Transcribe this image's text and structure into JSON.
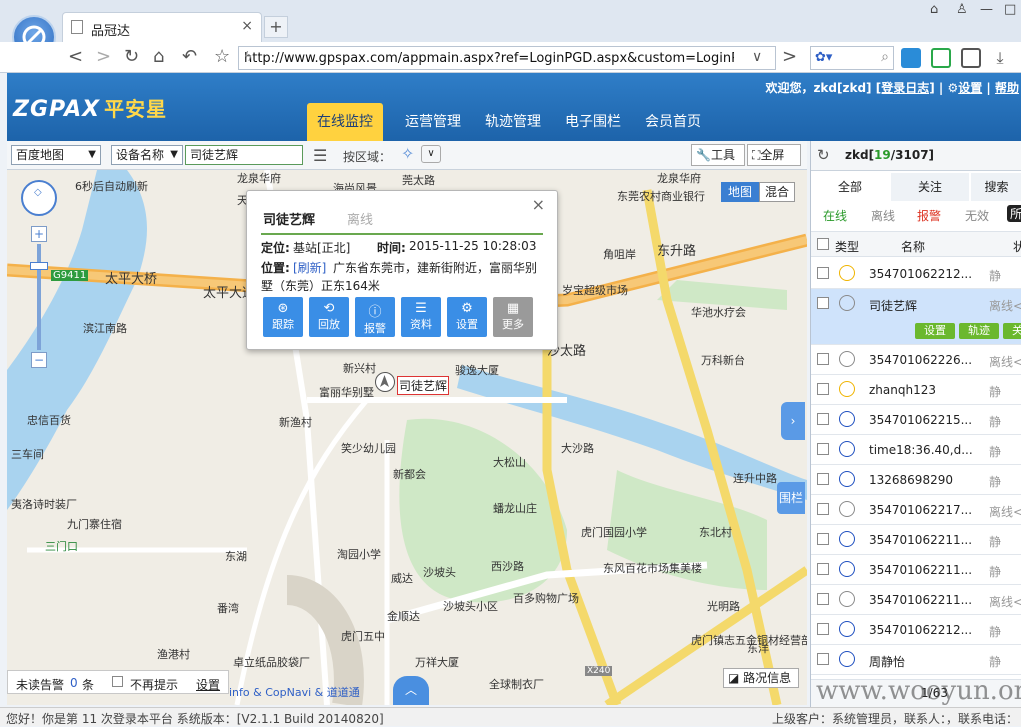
{
  "browser": {
    "tab_title": "品冠达",
    "url": "http://www.gpspax.com/appmain.aspx?ref=LoginPGD.aspx&custom=LoginPGD"
  },
  "header": {
    "brand_latin": "ZGPAX",
    "brand_cn": "平安星",
    "user_greeting": "欢迎您，zkd[zkd]",
    "logout": "[登录日志]",
    "settings": "设置",
    "help": "帮助",
    "nav": [
      "在线监控",
      "运营管理",
      "轨迹管理",
      "电子围栏",
      "会员首页"
    ]
  },
  "map_toolbar": {
    "map_select": "百度地图",
    "field_select": "设备名称",
    "search_value": "司徒艺辉",
    "region_label": "按区域：",
    "tools": "工具",
    "fullscreen": "全屏"
  },
  "map": {
    "refresh_notice": "6秒后自动刷新",
    "map_type": "地图",
    "hybrid": "混合",
    "traffic": "路况信息",
    "fence_label": "围栏",
    "credits": "info & CopNavi & 道道通",
    "labels": [
      "龙泉华府",
      "天平国际",
      "海尚风景",
      "东莞农村商业银行",
      "龙泉华府",
      "太平大桥",
      "太平大道",
      "G9411",
      "莞太路",
      "东升路",
      "沙太路",
      "滨江南路",
      "岁宝超级市场",
      "华池水疗会",
      "万科新台",
      "新兴村",
      "骏逸大厦",
      "富丽华别墅",
      "新渔村",
      "笑少幼儿园",
      "大松山",
      "蟠龙山庄",
      "虎门国园小学",
      "东北村",
      "东风百花市场集美楼",
      "西沙路",
      "淘园小学",
      "威达",
      "沙坡头",
      "百多购物广场",
      "番湾",
      "金顺达",
      "沙坡头小区",
      "虎门五中",
      "渔港村",
      "卓立纸品胶袋厂",
      "万祥大厦",
      "全球制衣厂",
      "光明路",
      "大沙路",
      "连升中路",
      "东湖",
      "三门口",
      "九门寨住宿",
      "夷洛诗时装厂",
      "新都会",
      "三车间",
      "忠信百货",
      "角咀岸",
      "虎门镇志五金铜材经营部",
      "X240",
      "东洋"
    ],
    "marker_label": "司徒艺辉",
    "unread_alarm": "未读告警",
    "unread_count": "0",
    "unread_unit": "条",
    "no_remind": "不再提示",
    "settings_link": "设置"
  },
  "popup": {
    "name": "司徒艺辉",
    "status": "离线",
    "loc_label": "定位:",
    "loc_value": "基站[正北]",
    "time_label": "时间:",
    "time_value": "2015-11-25 10:28:03",
    "pos_label": "位置:",
    "refresh": "[刷新]",
    "address": "广东省东莞市，建新街附近，富丽华别墅（东莞）正东164米",
    "buttons": [
      "跟踪",
      "回放",
      "报警",
      "资料",
      "设置",
      "更多"
    ]
  },
  "right_panel": {
    "user": "zkd",
    "online": "19",
    "total": "3107",
    "tabs": [
      "全部",
      "关注",
      "搜索"
    ],
    "filters": [
      "在线",
      "离线",
      "报警",
      "无效",
      "所"
    ],
    "col_type": "类型",
    "col_name": "名称",
    "col_status": "状",
    "rows": [
      {
        "name": "354701062212...",
        "status": "静",
        "color": "#f0b400"
      },
      {
        "name": "司徒艺辉",
        "status": "离线<",
        "color": "#8a8a8a",
        "selected": true
      },
      {
        "name": "354701062226...",
        "status": "离线<",
        "color": "#8a8a8a"
      },
      {
        "name": "zhanqh123",
        "status": "静",
        "color": "#f0b400"
      },
      {
        "name": "354701062215...",
        "status": "静",
        "color": "#2050c0"
      },
      {
        "name": "time18:36.40,d...",
        "status": "静",
        "color": "#2050c0"
      },
      {
        "name": "13268698290",
        "status": "静",
        "color": "#2050c0"
      },
      {
        "name": "354701062217...",
        "status": "离线<",
        "color": "#8a8a8a"
      },
      {
        "name": "354701062211...",
        "status": "静",
        "color": "#2050c0"
      },
      {
        "name": "354701062211...",
        "status": "静",
        "color": "#2050c0"
      },
      {
        "name": "354701062211...",
        "status": "离线<",
        "color": "#8a8a8a"
      },
      {
        "name": "354701062212...",
        "status": "静",
        "color": "#2050c0"
      },
      {
        "name": "周静怡",
        "status": "静",
        "color": "#2050c0"
      }
    ],
    "row_actions": [
      "设置",
      "轨迹",
      "关注"
    ],
    "pager": "1/63"
  },
  "statusbar": {
    "left": "您好！你是第 11 次登录本平台  系统版本：[V2.1.1 Build 20140820]",
    "right": "上级客户：系统管理员，联系人：，联系电话："
  },
  "watermark": "www.wooyun.org"
}
